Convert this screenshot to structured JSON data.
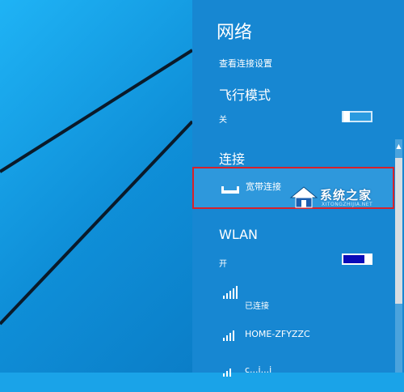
{
  "panel": {
    "title": "网络",
    "view_settings": "查看连接设置"
  },
  "airplane": {
    "label": "飞行模式",
    "state": "关"
  },
  "connections": {
    "label": "连接",
    "broadband_name": "宽带连接"
  },
  "wlan": {
    "label": "WLAN",
    "state": "开",
    "networks": [
      {
        "name": "",
        "status": "已连接"
      },
      {
        "name": "HOME-ZFYZZC",
        "status": ""
      },
      {
        "name": "c...i...i",
        "status": ""
      }
    ]
  },
  "watermark": {
    "text": "系统之家",
    "sub": "XITONGZHIJIA.NET"
  },
  "colors": {
    "panel_bg": "#1787d2",
    "desktop_bg": "#1aa3e8",
    "highlight_border": "#d7212b",
    "toggle_on": "#0a0ab8"
  }
}
